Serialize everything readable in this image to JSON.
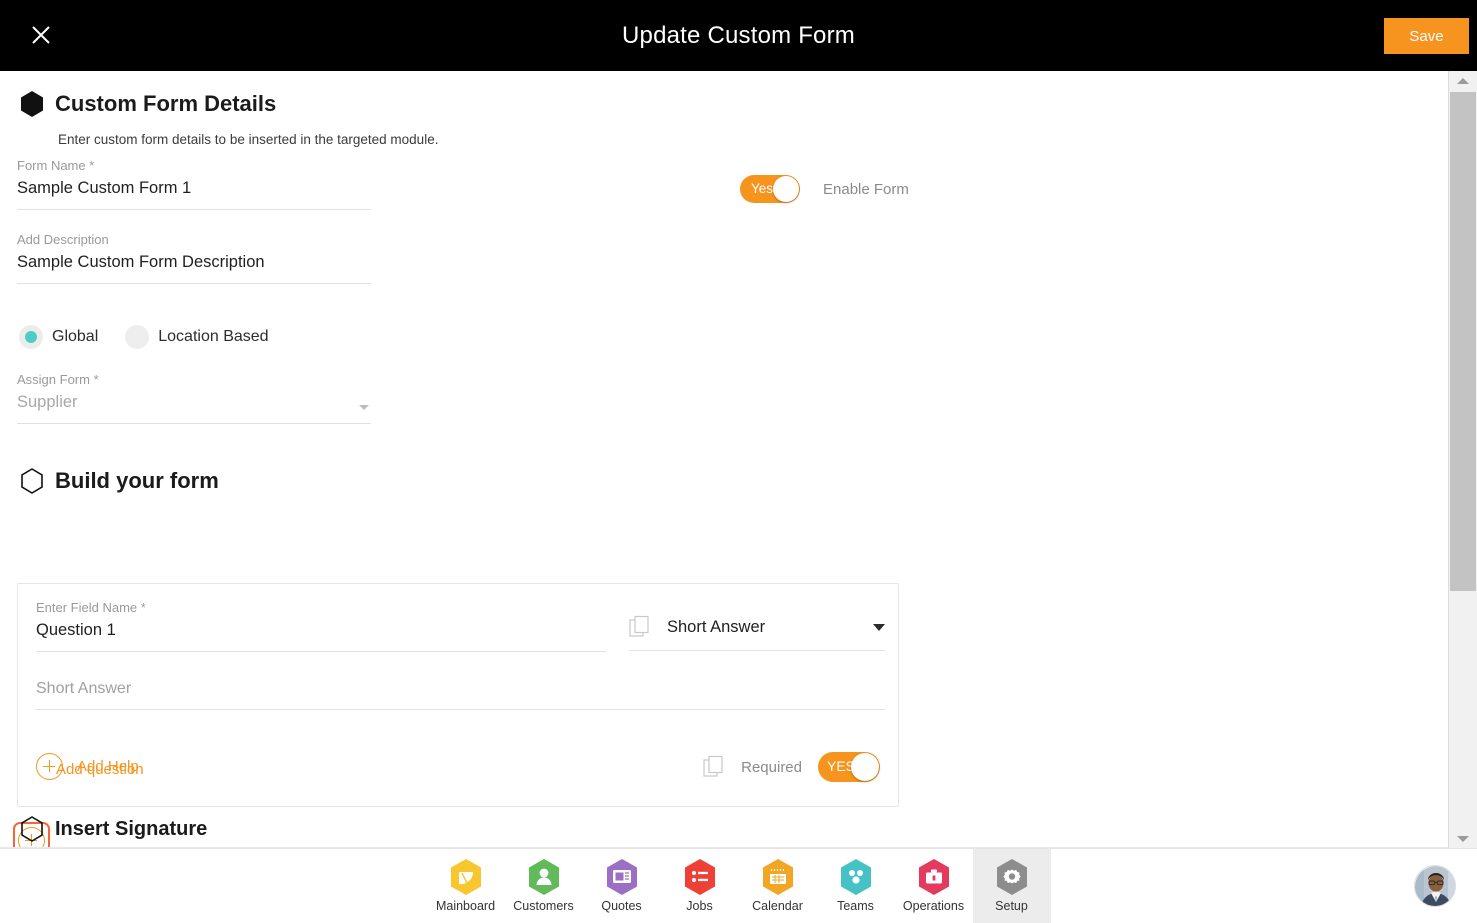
{
  "topbar": {
    "close_icon": "close-icon",
    "title": "Update Custom Form",
    "save_label": "Save"
  },
  "details": {
    "heading": "Custom Form Details",
    "subheading": "Enter custom form details to be inserted in the targeted module.",
    "form_name": {
      "label": "Form Name *",
      "value": "Sample Custom Form 1"
    },
    "description": {
      "label": "Add Description",
      "value": "Sample Custom Form Description"
    },
    "enable_form": {
      "toggle_label": "Yes",
      "caption": "Enable Form",
      "state": "on"
    },
    "scope": {
      "options": [
        {
          "label": "Global",
          "selected": true
        },
        {
          "label": "Location Based",
          "selected": false
        }
      ]
    },
    "assign_form": {
      "label": "Assign Form *",
      "value": "Supplier",
      "is_placeholder": true
    }
  },
  "build": {
    "heading": "Build your form",
    "question": {
      "field_name_label": "Enter Field Name *",
      "field_name_value": "Question 1",
      "type_value": "Short Answer",
      "answer_placeholder": "Short Answer",
      "add_help_label": "Add Help",
      "required_label": "Required",
      "required_toggle_label": "YES",
      "copy_icon": "duplicate-icon"
    },
    "add_question_label": "Add question"
  },
  "signature": {
    "heading": "Insert Signature"
  },
  "bottom_nav": {
    "items": [
      {
        "label": "Mainboard",
        "icon": "mainboard-icon",
        "color": "#f8c62e",
        "active": false
      },
      {
        "label": "Customers",
        "icon": "customers-icon",
        "color": "#62bb5b",
        "active": false
      },
      {
        "label": "Quotes",
        "icon": "quotes-icon",
        "color": "#9b6fc4",
        "active": false
      },
      {
        "label": "Jobs",
        "icon": "jobs-icon",
        "color": "#ee4036",
        "active": false
      },
      {
        "label": "Calendar",
        "icon": "calendar-icon",
        "color": "#f2a623",
        "active": false
      },
      {
        "label": "Teams",
        "icon": "teams-icon",
        "color": "#45c2c4",
        "active": false
      },
      {
        "label": "Operations",
        "icon": "operations-icon",
        "color": "#e33a5e",
        "active": false
      },
      {
        "label": "Setup",
        "icon": "setup-icon",
        "color": "#8d8d8d",
        "active": true
      }
    ],
    "avatar": "user-avatar"
  },
  "colors": {
    "accent_orange": "#f7941d",
    "focus_orange": "#f4663a",
    "radio_teal": "#4ecdc4",
    "topbar_black": "#000000"
  }
}
